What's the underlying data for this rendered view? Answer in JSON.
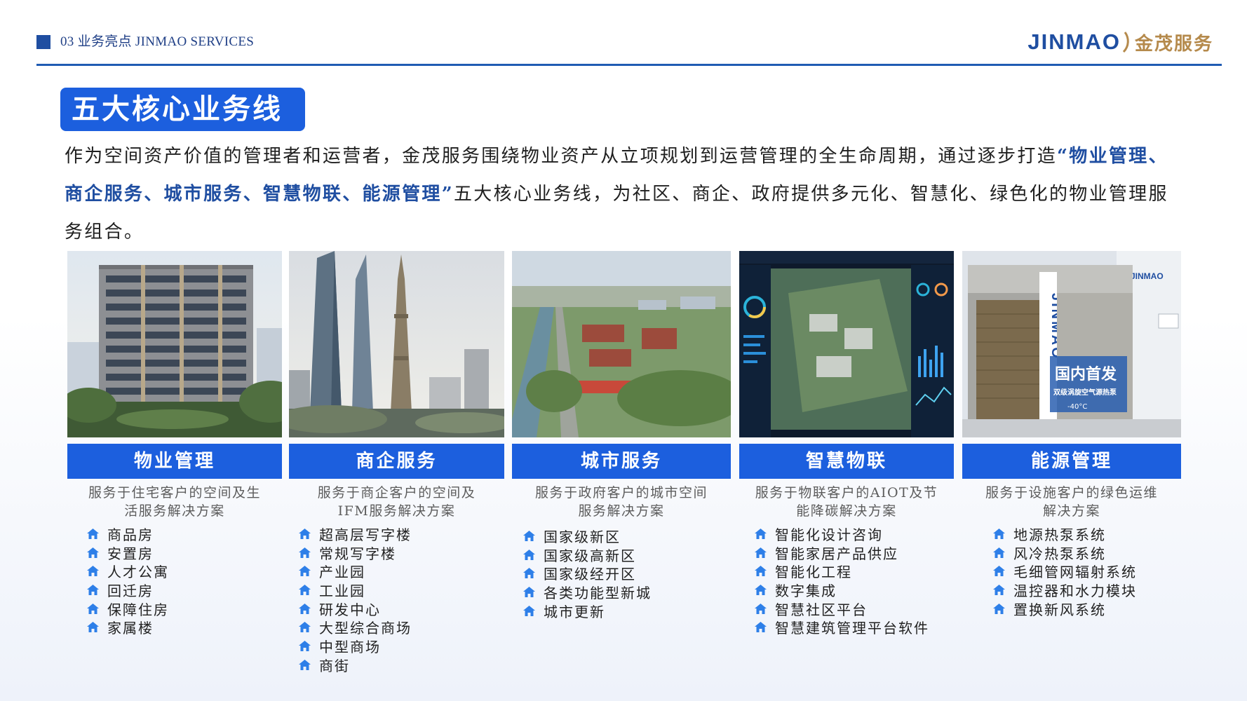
{
  "header": {
    "section": "03 业务亮点  JINMAO SERVICES",
    "logo_en": "JINMAO",
    "logo_cn": "金茂服务"
  },
  "title": "五大核心业务线",
  "intro": {
    "part1": "作为空间资产价值的管理者和运营者，金茂服务围绕物业资产从立项规划到运营管理的全生命周期，通过逐步打造",
    "highlight": "“物业管理、商企服务、城市服务、智慧物联、能源管理”",
    "part2": "五大核心业务线，为社区、商企、政府提供多元化、智慧化、绿色化的物业管理服务组合。"
  },
  "cards": [
    {
      "title": "物业管理",
      "desc": [
        "服务于住宅客户的空间及生",
        "活服务解决方案"
      ],
      "items": [
        "商品房",
        "安置房",
        "人才公寓",
        "回迁房",
        "保障住房",
        "家属楼"
      ]
    },
    {
      "title": "商企服务",
      "desc": [
        "服务于商企客户的空间及",
        "IFM服务解决方案"
      ],
      "items": [
        "超高层写字楼",
        "常规写字楼",
        "产业园",
        "工业园",
        "研发中心",
        "大型综合商场",
        "中型商场",
        "商街"
      ]
    },
    {
      "title": "城市服务",
      "desc": [
        "服务于政府客户的城市空间",
        "服务解决方案"
      ],
      "items": [
        "国家级新区",
        "国家级高新区",
        "国家级经开区",
        "各类功能型新城",
        "城市更新"
      ]
    },
    {
      "title": "智慧物联",
      "desc": [
        "服务于物联客户的AIOT及节",
        "能降碳解决方案"
      ],
      "items": [
        "智能化设计咨询",
        "智能家居产品供应",
        "智能化工程",
        "数字集成",
        "智慧社区平台",
        "智慧建筑管理平台软件"
      ]
    },
    {
      "title": "能源管理",
      "desc": [
        "服务于设施客户的绿色运维",
        "解决方案"
      ],
      "items": [
        "地源热泵系统",
        "风冷热泵系统",
        "毛细管网辐射系统",
        "温控器和水力模块",
        "置换新风系统"
      ]
    }
  ],
  "photo_text": {
    "machine_brand": "JINMAO",
    "banner_main": "国内首发",
    "banner_sub": "双级涡旋空气源热泵",
    "temp": "-40°C"
  },
  "colors": {
    "brand_blue": "#1c5fde",
    "navy": "#1f4ea1",
    "logo_gold": "#b58a4c"
  }
}
